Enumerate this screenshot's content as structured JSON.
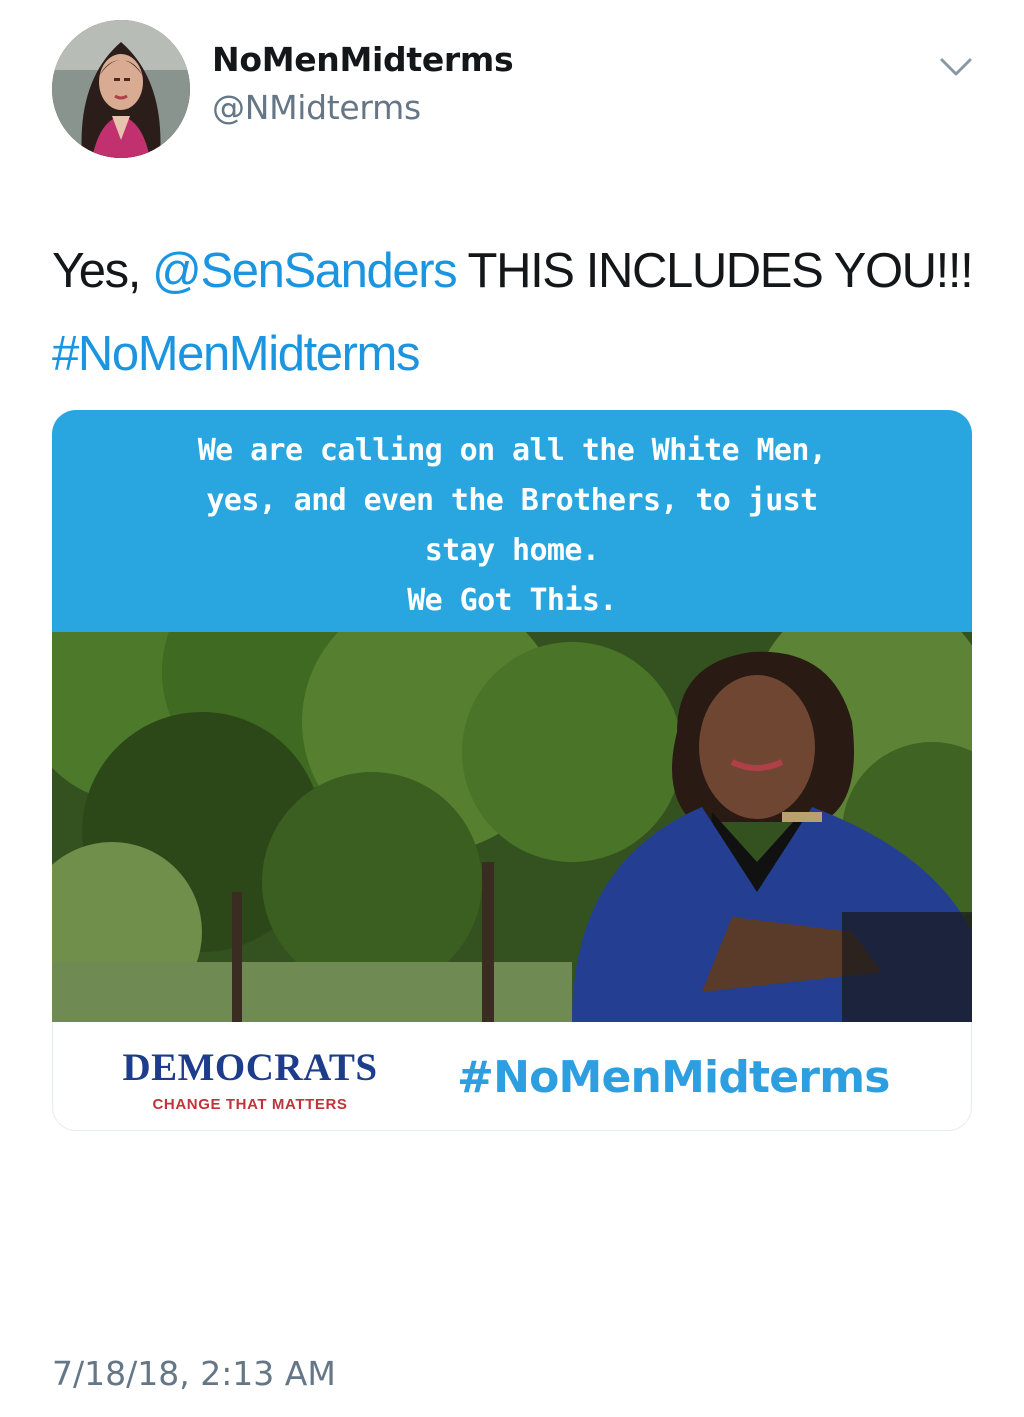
{
  "header": {
    "display_name": "NoMenMidterms",
    "handle": "@NMidterms"
  },
  "tweet": {
    "text_prefix": "Yes, ",
    "mention": "@SenSanders",
    "text_middle": " THIS INCLUDES YOU!!! ",
    "hashtag": "#NoMenMidterms",
    "timestamp": "7/18/18, 2:13 AM"
  },
  "card": {
    "banner_text": "We are calling on all the White Men,\nyes, and even the Brothers, to just\nstay home.\nWe Got This.",
    "logo_title": "DEMOCRATS",
    "logo_subtitle": "CHANGE THAT MATTERS",
    "footer_hashtag": "#NoMenMidterms"
  },
  "colors": {
    "link": "#1b95e0",
    "banner": "#29a6e0",
    "democrats_blue": "#1d3d8c",
    "democrats_red": "#c0333b"
  },
  "icons": {
    "menu": "chevron-down-icon"
  }
}
